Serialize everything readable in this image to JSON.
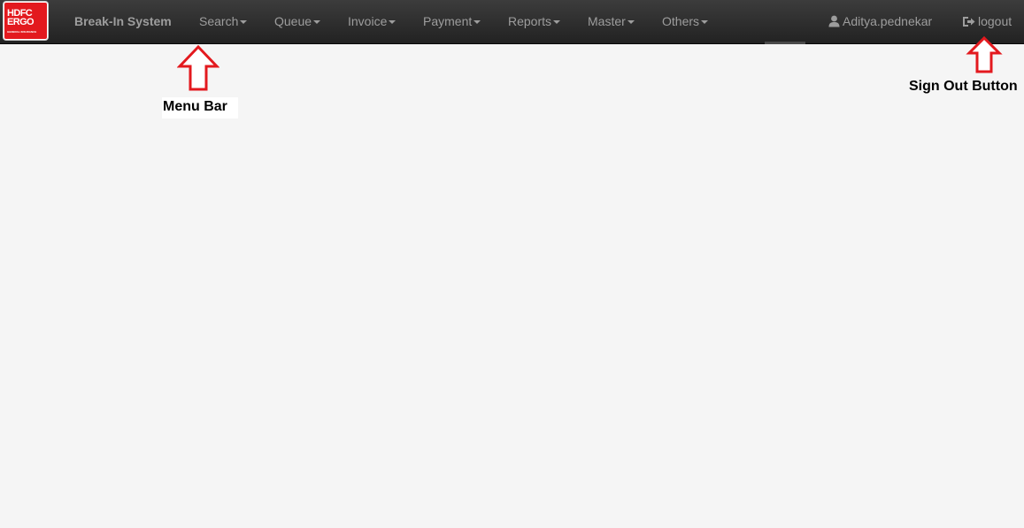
{
  "navbar": {
    "logo": {
      "line1": "HDFC",
      "line2": "ERGO",
      "line3": "GENERAL INSURANCE",
      "color": "#e3191e"
    },
    "brand": "Break-In System",
    "menu": [
      {
        "label": "Search",
        "name": "menu-search"
      },
      {
        "label": "Queue",
        "name": "menu-queue"
      },
      {
        "label": "Invoice",
        "name": "menu-invoice"
      },
      {
        "label": "Payment",
        "name": "menu-payment"
      },
      {
        "label": "Reports",
        "name": "menu-reports"
      },
      {
        "label": "Master",
        "name": "menu-master"
      },
      {
        "label": "Others",
        "name": "menu-others"
      }
    ],
    "user": {
      "icon": "user-icon",
      "name": "Aditya.pednekar"
    },
    "logout": {
      "icon": "logout-icon",
      "label": "logout"
    }
  },
  "annotations": {
    "menu_bar_label": "Menu Bar",
    "sign_out_label": "Sign Out Button",
    "arrow_color": "#e3191e"
  }
}
